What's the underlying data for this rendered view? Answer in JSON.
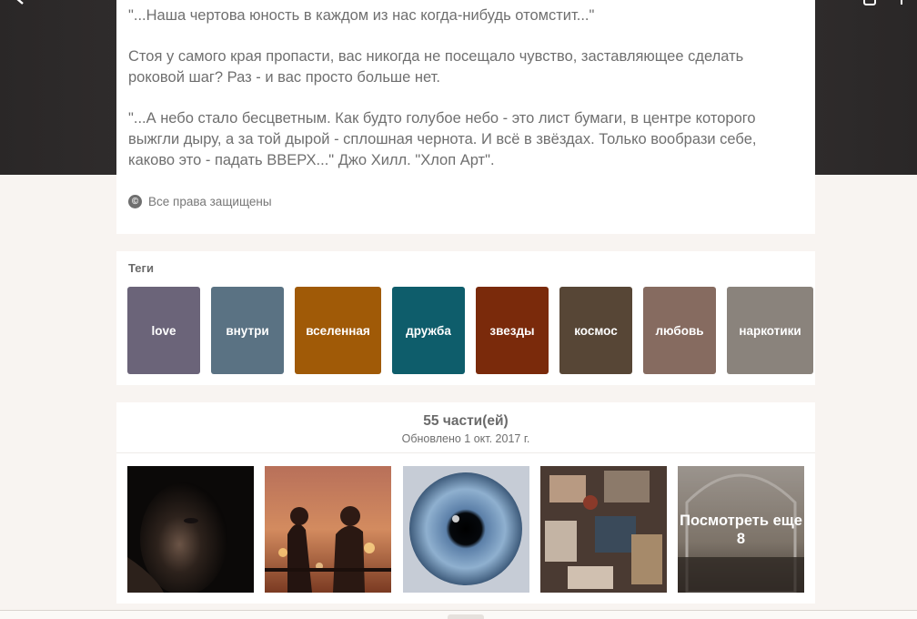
{
  "story": {
    "paragraphs": [
      "\"...Наша чертова юность в каждом из нас когда-нибудь отомстит...\"",
      "Стоя у самого края пропасти, вас никогда не посещало чувство, заставляющее сделать роковой шаг? Раз - и вас просто больше нет.",
      "\"...А небо стало бесцветным. Как будто голубое небо - это лист бумаги, в центре которого выжгли дыру, а за той дырой - сплошная чернота. И всё в звёздах. Только вообрази себе, каково это - падать ВВЕРХ...\" Джо Хилл. \"Хлоп Арт\"."
    ],
    "copyright_icon": "©",
    "copyright_label": "Все права защищены"
  },
  "tags": {
    "title": "Теги",
    "items": [
      {
        "label": "love",
        "color": "#6b6479"
      },
      {
        "label": "внутри",
        "color": "#5a7283"
      },
      {
        "label": "вселенная",
        "color": "#a05a07"
      },
      {
        "label": "дружба",
        "color": "#0e5d6b"
      },
      {
        "label": "звезды",
        "color": "#7a2a0b"
      },
      {
        "label": "космос",
        "color": "#574636"
      },
      {
        "label": "любовь",
        "color": "#866b60"
      },
      {
        "label": "наркотики",
        "color": "#8a837c"
      }
    ]
  },
  "parts": {
    "count": "55 части(ей)",
    "updated": "Обновлено 1 окт. 2017 г.",
    "more_label": "Посмотреть еще 8"
  },
  "icons": {
    "back": "chevron-left-icon",
    "bookmark": "bookmark-icon",
    "add": "plus-icon",
    "copyright": "copyright-icon"
  }
}
